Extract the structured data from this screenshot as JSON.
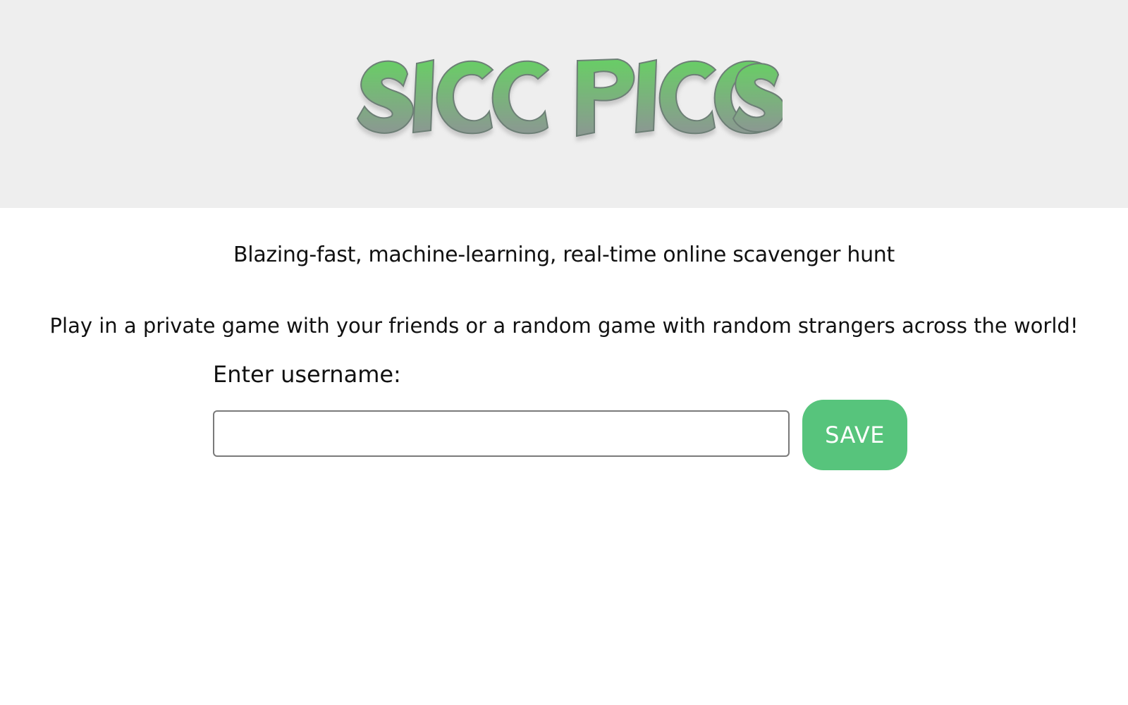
{
  "header": {
    "logo_text": "Sicc Piccs"
  },
  "main": {
    "tagline": "Blazing-fast, machine-learning, real-time online scavenger hunt",
    "description": "Play in a private game with your friends or a random game with random strangers across the world!",
    "username": {
      "label": "Enter username:",
      "value": "",
      "placeholder": ""
    },
    "save_label": "SAVE"
  },
  "colors": {
    "header_background": "#eeeeee",
    "logo_green": "#6acb6f",
    "logo_gray": "#8a9a92",
    "save_button": "#57c47c",
    "save_text": "#ffffff"
  }
}
